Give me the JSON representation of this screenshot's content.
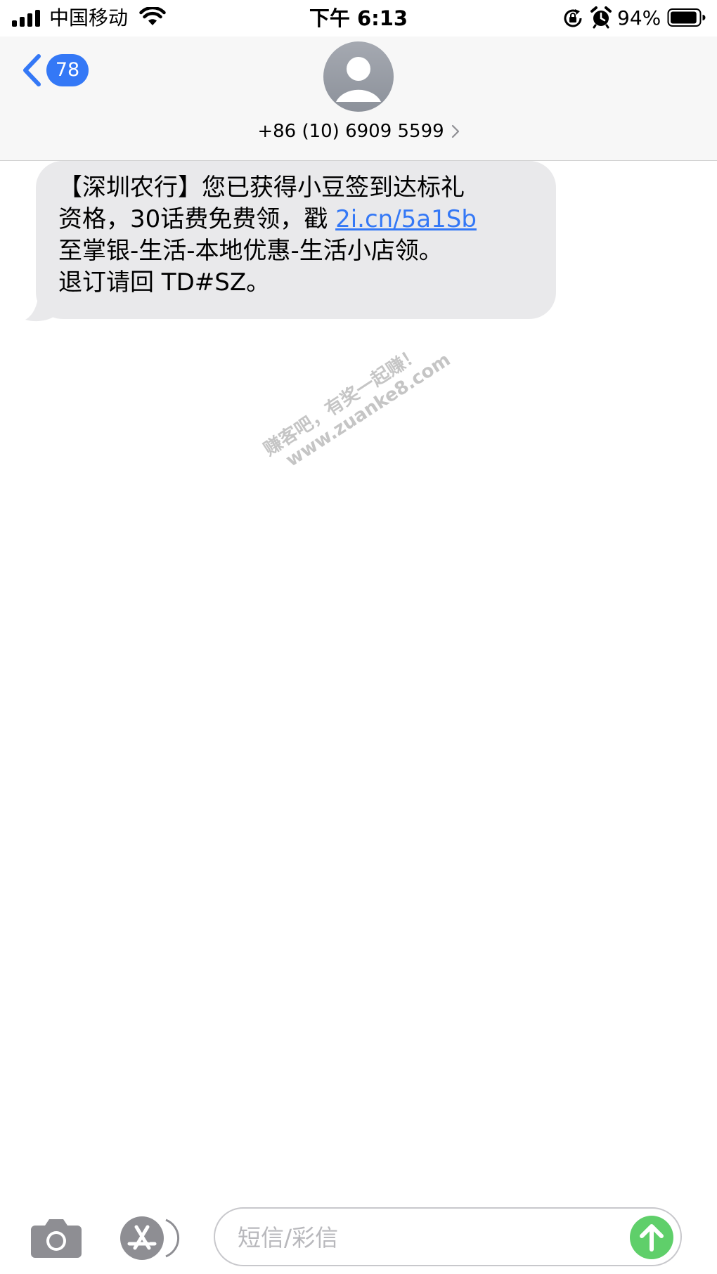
{
  "status_bar": {
    "carrier": "中国移动",
    "time": "下午 6:13",
    "battery_percent": "94%",
    "battery_level": 0.94,
    "signal_bars": 4,
    "icons": [
      "signal-icon",
      "wifi-icon",
      "rotation-lock-icon",
      "alarm-icon",
      "battery-icon"
    ]
  },
  "header": {
    "back_badge": "78",
    "contact": "+86 (10) 6909 5599",
    "icons": [
      "back-chevron-icon",
      "person-icon",
      "chevron-right-icon"
    ]
  },
  "message": {
    "line1": "【深圳农行】您已获得小豆签到达标礼",
    "line2_prefix": "资格，30话费免费领，戳 ",
    "link": "2i.cn/5a1Sb",
    "line3": "至掌银-生活-本地优惠-生活小店领。",
    "line4": "退订请回 TD#SZ。"
  },
  "watermark": {
    "line1": "赚客吧，有奖一起赚！",
    "line2": "www.zuanke8.com"
  },
  "input_bar": {
    "placeholder": "短信/彩信",
    "icons": [
      "camera-icon",
      "app-store-icon",
      "send-arrow-icon"
    ]
  },
  "colors": {
    "accent": "#3478f6",
    "bubble": "#e9e9eb",
    "send": "#5fcf6a",
    "header_bg": "#f7f7f7"
  }
}
